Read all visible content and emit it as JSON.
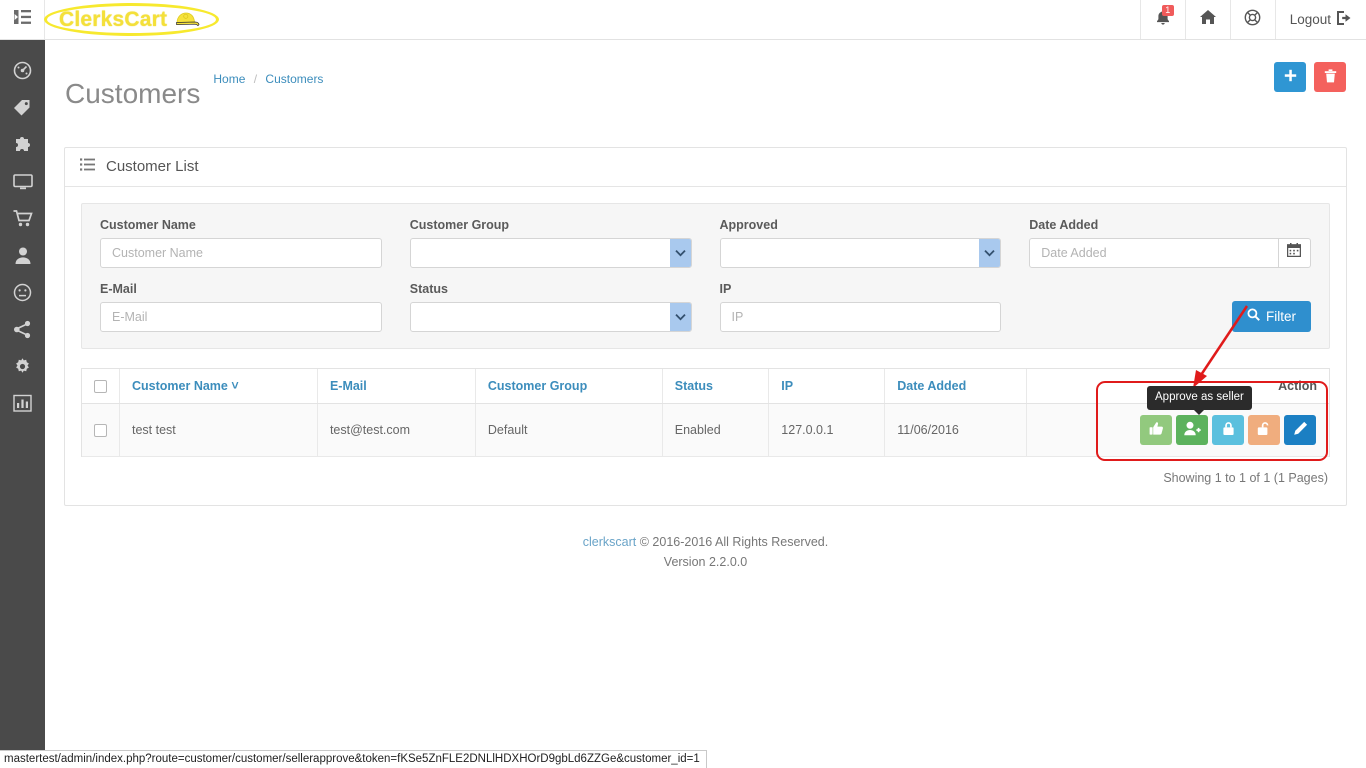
{
  "header": {
    "nav_toggle_icon": "list-indent-icon",
    "brand": "ClerksCart",
    "brand_icon": "cap-icon",
    "notifications": {
      "icon": "bell-icon",
      "count": "1"
    },
    "home": {
      "icon": "home-icon"
    },
    "support": {
      "icon": "lifebuoy-icon"
    },
    "logout": {
      "label": "Logout",
      "icon": "sign-out-icon"
    }
  },
  "sidebar": {
    "items": [
      {
        "name": "dashboard",
        "icon": "dashboard-gauge-icon"
      },
      {
        "name": "catalog",
        "icon": "tags-icon"
      },
      {
        "name": "extensions",
        "icon": "puzzle-icon"
      },
      {
        "name": "design",
        "icon": "monitor-icon"
      },
      {
        "name": "sales",
        "icon": "shopping-cart-icon"
      },
      {
        "name": "customers",
        "icon": "user-icon"
      },
      {
        "name": "marketing",
        "icon": "smiley-icon"
      },
      {
        "name": "system",
        "icon": "share-icon"
      },
      {
        "name": "settings",
        "icon": "gear-icon"
      },
      {
        "name": "reports",
        "icon": "bar-chart-icon"
      }
    ]
  },
  "page": {
    "title": "Customers",
    "breadcrumb": {
      "home": "Home",
      "separator": "/",
      "current": "Customers"
    },
    "add_button": {
      "icon": "plus-icon"
    },
    "delete_button": {
      "icon": "trash-icon"
    }
  },
  "panel": {
    "icon": "list-icon",
    "title": "Customer List"
  },
  "filter": {
    "customer_name": {
      "label": "Customer Name",
      "placeholder": "Customer Name",
      "value": ""
    },
    "customer_group": {
      "label": "Customer Group",
      "value": "",
      "options": [
        ""
      ]
    },
    "approved": {
      "label": "Approved",
      "value": "",
      "options": [
        ""
      ]
    },
    "date_added": {
      "label": "Date Added",
      "placeholder": "Date Added",
      "value": "",
      "icon": "calendar-icon"
    },
    "email": {
      "label": "E-Mail",
      "placeholder": "E-Mail",
      "value": ""
    },
    "status": {
      "label": "Status",
      "value": "",
      "options": [
        ""
      ]
    },
    "ip": {
      "label": "IP",
      "placeholder": "IP",
      "value": ""
    },
    "filter_button": {
      "label": "Filter",
      "icon": "search-icon"
    }
  },
  "table": {
    "columns": [
      "Customer Name",
      "E-Mail",
      "Customer Group",
      "Status",
      "IP",
      "Date Added",
      "Action"
    ],
    "sort_indicator": "˅",
    "rows": [
      {
        "customer_name": "test test",
        "email": "test@test.com",
        "customer_group": "Default",
        "status": "Enabled",
        "ip": "127.0.0.1",
        "date_added": "11/06/2016"
      }
    ],
    "row_actions": [
      {
        "name": "approve-customer",
        "icon": "thumbs-up-icon",
        "color": "#92c97e"
      },
      {
        "name": "approve-as-seller",
        "icon": "user-plus-icon",
        "color": "#5cb25d"
      },
      {
        "name": "lock",
        "icon": "lock-icon",
        "color": "#5bc0de"
      },
      {
        "name": "unlock",
        "icon": "unlock-icon",
        "color": "#f0ad7e"
      },
      {
        "name": "edit",
        "icon": "pencil-icon",
        "color": "#1b7fc3"
      }
    ],
    "pagination": "Showing 1 to 1 of 1 (1 Pages)"
  },
  "tooltip": {
    "text": "Approve as seller"
  },
  "footer": {
    "brand_link": "clerkscart",
    "copyright": "© 2016-2016 All Rights Reserved.",
    "version": "Version 2.2.0.0"
  },
  "status_bar": {
    "url": "mastertest/admin/index.php?route=customer/customer/sellerapprove&token=fKSe5ZnFLE2DNLlHDXHOrD9gbLd6ZZGe&customer_id=1"
  }
}
